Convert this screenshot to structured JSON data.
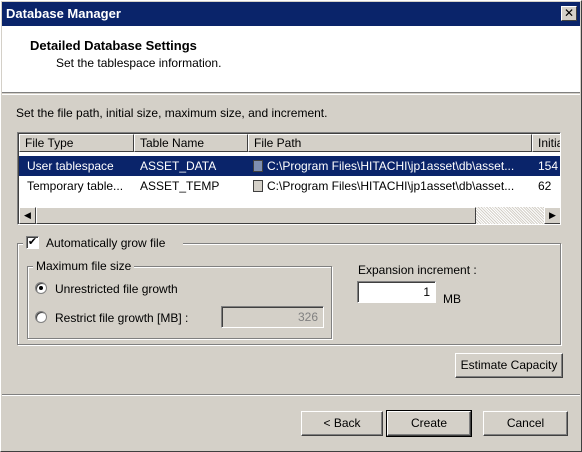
{
  "window": {
    "title": "Database Manager",
    "close_glyph": "✕"
  },
  "header": {
    "title": "Detailed Database Settings",
    "subtitle": "Set the tablespace information."
  },
  "instruction": "Set the file path, initial size, maximum size, and increment.",
  "table": {
    "columns": [
      "File Type",
      "Table Name",
      "File Path",
      "Initia"
    ],
    "rows": [
      {
        "file_type": "User tablespace",
        "table_name": "ASSET_DATA",
        "file_path": "C:\\Program Files\\HITACHI\\jp1asset\\db\\asset...",
        "initial": "154",
        "selected": true
      },
      {
        "file_type": "Temporary table...",
        "table_name": "ASSET_TEMP",
        "file_path": "C:\\Program Files\\HITACHI\\jp1asset\\db\\asset...",
        "initial": "62",
        "selected": false
      }
    ],
    "scroll_left_icon": "◀",
    "scroll_right_icon": "▶"
  },
  "auto_grow": {
    "label": "Automatically grow file",
    "checked": true,
    "check_glyph": "✔"
  },
  "max_size": {
    "legend": "Maximum file size",
    "unrestricted_label": "Unrestricted file growth",
    "restrict_label": "Restrict file growth [MB] :",
    "selected": "unrestricted",
    "restrict_value": "326"
  },
  "expansion": {
    "label": "Expansion increment :",
    "value": "1",
    "unit": "MB"
  },
  "buttons": {
    "estimate": "Estimate Capacity",
    "back": "< Back",
    "create": "Create",
    "cancel": "Cancel"
  },
  "colors": {
    "title_bar": "#0a246a",
    "selection": "#0a246a",
    "face": "#d4d0c8"
  }
}
